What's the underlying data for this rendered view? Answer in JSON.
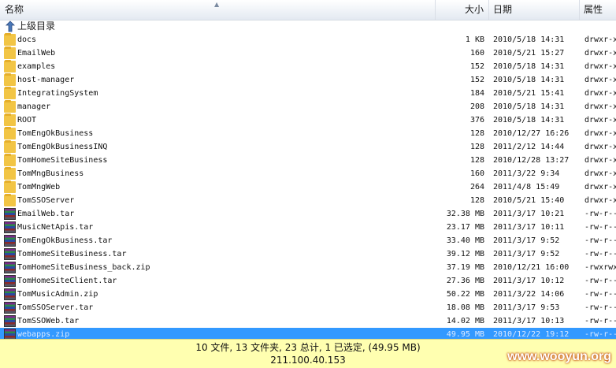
{
  "columns": {
    "name": "名称",
    "size": "大小",
    "date": "日期",
    "attr": "属性"
  },
  "up_label": "上级目录",
  "files": [
    {
      "name": "docs",
      "size": "1 KB",
      "date": "2010/5/18 14:31",
      "attr": "drwxr-xr-x",
      "icon": "folder-icon",
      "type": "folder"
    },
    {
      "name": "EmailWeb",
      "size": "160",
      "date": "2010/5/21 15:27",
      "attr": "drwxr-xr-x",
      "icon": "folder-icon",
      "type": "folder"
    },
    {
      "name": "examples",
      "size": "152",
      "date": "2010/5/18 14:31",
      "attr": "drwxr-xr-x",
      "icon": "folder-icon",
      "type": "folder"
    },
    {
      "name": "host-manager",
      "size": "152",
      "date": "2010/5/18 14:31",
      "attr": "drwxr-xr-x",
      "icon": "folder-icon",
      "type": "folder"
    },
    {
      "name": "IntegratingSystem",
      "size": "184",
      "date": "2010/5/21 15:41",
      "attr": "drwxr-xr-x",
      "icon": "folder-icon",
      "type": "folder"
    },
    {
      "name": "manager",
      "size": "208",
      "date": "2010/5/18 14:31",
      "attr": "drwxr-xr-x",
      "icon": "folder-icon",
      "type": "folder"
    },
    {
      "name": "ROOT",
      "size": "376",
      "date": "2010/5/18 14:31",
      "attr": "drwxr-xr-x",
      "icon": "folder-icon",
      "type": "folder"
    },
    {
      "name": "TomEngOkBusiness",
      "size": "128",
      "date": "2010/12/27 16:26",
      "attr": "drwxr-xr-x",
      "icon": "folder-icon",
      "type": "folder"
    },
    {
      "name": "TomEngOkBusinessINQ",
      "size": "128",
      "date": "2011/2/12 14:44",
      "attr": "drwxr-xr-x",
      "icon": "folder-icon",
      "type": "folder"
    },
    {
      "name": "TomHomeSiteBusiness",
      "size": "128",
      "date": "2010/12/28 13:27",
      "attr": "drwxr-xr-x",
      "icon": "folder-icon",
      "type": "folder"
    },
    {
      "name": "TomMngBusiness",
      "size": "160",
      "date": "2011/3/22 9:34",
      "attr": "drwxr-xr-x",
      "icon": "folder-icon",
      "type": "folder"
    },
    {
      "name": "TomMngWeb",
      "size": "264",
      "date": "2011/4/8 15:49",
      "attr": "drwxr-xr-x",
      "icon": "folder-icon",
      "type": "folder"
    },
    {
      "name": "TomSSOServer",
      "size": "128",
      "date": "2010/5/21 15:40",
      "attr": "drwxr-xr-x",
      "icon": "folder-icon",
      "type": "folder"
    },
    {
      "name": "EmailWeb.tar",
      "size": "32.38 MB",
      "date": "2011/3/17 10:21",
      "attr": "-rw-r--r--",
      "icon": "archive-icon",
      "type": "archive"
    },
    {
      "name": "MusicNetApis.tar",
      "size": "23.17 MB",
      "date": "2011/3/17 10:11",
      "attr": "-rw-r--r--",
      "icon": "archive-icon",
      "type": "archive"
    },
    {
      "name": "TomEngOkBusiness.tar",
      "size": "33.40 MB",
      "date": "2011/3/17 9:52",
      "attr": "-rw-r--r--",
      "icon": "archive-icon",
      "type": "archive"
    },
    {
      "name": "TomHomeSiteBusiness.tar",
      "size": "39.12 MB",
      "date": "2011/3/17 9:52",
      "attr": "-rw-r--r--",
      "icon": "archive-icon",
      "type": "archive"
    },
    {
      "name": "TomHomeSiteBusiness_back.zip",
      "size": "37.19 MB",
      "date": "2010/12/21 16:00",
      "attr": "-rwxrwxrwx",
      "icon": "archive-icon",
      "type": "archive"
    },
    {
      "name": "TomHomeSiteClient.tar",
      "size": "27.36 MB",
      "date": "2011/3/17 10:12",
      "attr": "-rw-r--r--",
      "icon": "archive-icon",
      "type": "archive"
    },
    {
      "name": "TomMusicAdmin.zip",
      "size": "50.22 MB",
      "date": "2011/3/22 14:06",
      "attr": "-rw-r--r--",
      "icon": "archive-icon",
      "type": "archive"
    },
    {
      "name": "TomSSOServer.tar",
      "size": "18.08 MB",
      "date": "2011/3/17 9:53",
      "attr": "-rw-r--r--",
      "icon": "archive-icon",
      "type": "archive"
    },
    {
      "name": "TomSSOWeb.tar",
      "size": "14.02 MB",
      "date": "2011/3/17 10:13",
      "attr": "-rw-r--r--",
      "icon": "archive-icon",
      "type": "archive"
    },
    {
      "name": "webapps.zip",
      "size": "49.95 MB",
      "date": "2010/12/22 19:12",
      "attr": "-rw-r--r--",
      "icon": "archive-icon",
      "type": "archive",
      "selected": true
    }
  ],
  "status": {
    "summary": "10 文件, 13 文件夹, 23 总计, 1 已选定, (49.95 MB)",
    "host": "211.100.40.153"
  },
  "watermark": "www.wooyun.org"
}
